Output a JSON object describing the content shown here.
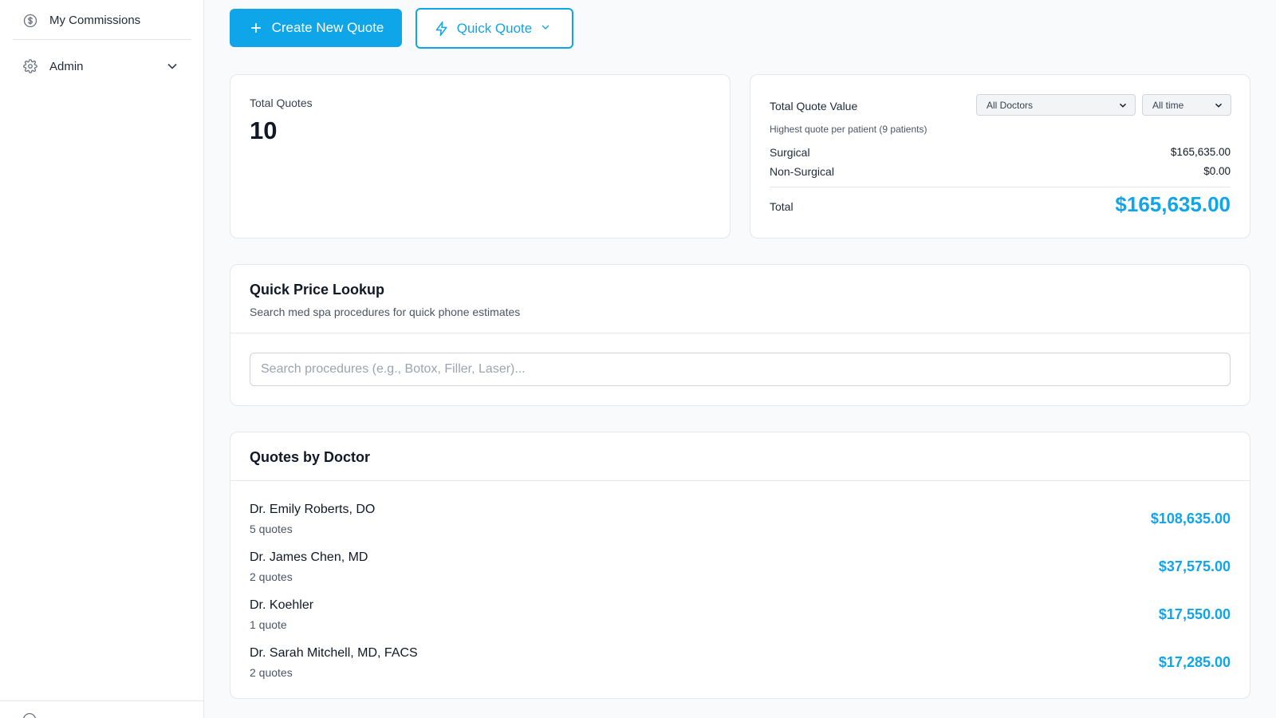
{
  "sidebar": {
    "items": [
      {
        "label": "My Commissions",
        "icon": "dollar-circle-icon"
      },
      {
        "label": "Admin",
        "icon": "gear-icon"
      }
    ]
  },
  "toolbar": {
    "create_label": "Create New Quote",
    "quick_label": "Quick Quote"
  },
  "total_quotes": {
    "label": "Total Quotes",
    "value": "10"
  },
  "quote_value": {
    "title": "Total Quote Value",
    "doctor_filter": "All Doctors",
    "time_filter": "All time",
    "subtitle": "Highest quote per patient (9 patients)",
    "surgical_label": "Surgical",
    "surgical_value": "$165,635.00",
    "nonsurgical_label": "Non-Surgical",
    "nonsurgical_value": "$0.00",
    "total_label": "Total",
    "total_value": "$165,635.00"
  },
  "lookup": {
    "title": "Quick Price Lookup",
    "description": "Search med spa procedures for quick phone estimates",
    "placeholder": "Search procedures (e.g., Botox, Filler, Laser)..."
  },
  "doctors": {
    "title": "Quotes by Doctor",
    "rows": [
      {
        "name": "Dr. Emily Roberts, DO",
        "count": "5 quotes",
        "amount": "$108,635.00"
      },
      {
        "name": "Dr. James Chen, MD",
        "count": "2 quotes",
        "amount": "$37,575.00"
      },
      {
        "name": "Dr. Koehler",
        "count": "1 quote",
        "amount": "$17,550.00"
      },
      {
        "name": "Dr. Sarah Mitchell, MD, FACS",
        "count": "2 quotes",
        "amount": "$17,285.00"
      }
    ]
  },
  "colors": {
    "accent": "#0ea5e9",
    "border": "#e5e7eb",
    "background": "#f9fafb"
  }
}
